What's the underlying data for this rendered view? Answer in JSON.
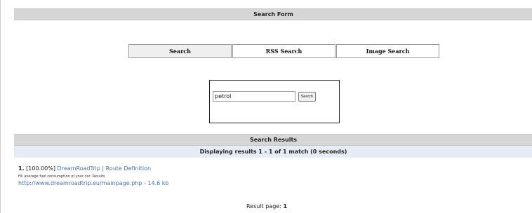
{
  "search_form": {
    "title": "Search Form",
    "tabs": [
      {
        "label": "Search",
        "active": true
      },
      {
        "label": "RSS Search",
        "active": false
      },
      {
        "label": "Image Search",
        "active": false
      }
    ],
    "query_value": "petrol",
    "search_button_label": "Search"
  },
  "results": {
    "title": "Search Results",
    "summary": "Displaying results 1 - 1 of 1 match (0 seconds)",
    "items": [
      {
        "number": "1.",
        "score": "[100.00%]",
        "title": "DreamRoadTrip | Route Definition",
        "description": "Fill average fuel consumption of your car: Results",
        "url": "http://www.dreamroadtrip.eu/mainpage.php",
        "size": "14.6 kb"
      }
    ],
    "page_label": "Result page:",
    "page_current": "1"
  },
  "colors": {
    "header_bar": "#d6d6d6",
    "summary_bar": "#e6ecf6",
    "link": "#4b6fb8"
  }
}
